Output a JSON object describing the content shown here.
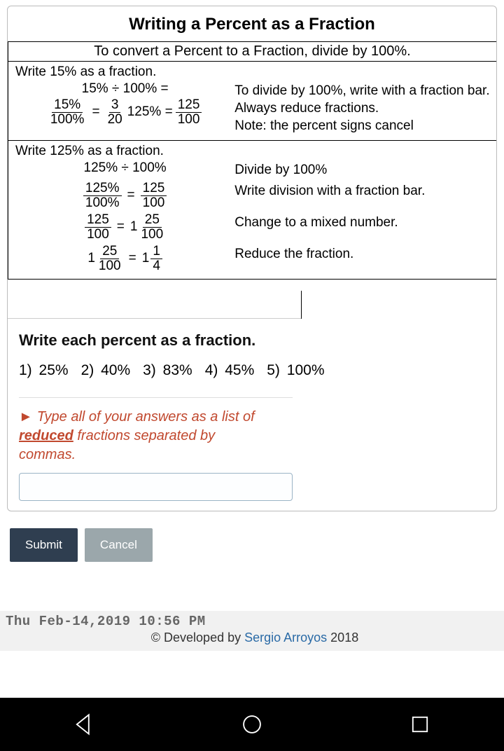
{
  "title": "Writing a Percent as a Fraction",
  "lesson": {
    "top_rule": "To convert a Percent to a Fraction, divide by 100%.",
    "ex1": {
      "prompt": "Write 15% as a fraction.",
      "line1": "15% ÷ 100% =",
      "f1_num": "15%",
      "f1_den": "100%",
      "f2_num": "3",
      "f2_den": "20",
      "mid_text": " 125% = ",
      "f3_num": "125",
      "f3_den": "100",
      "note1": "To divide by 100%, write with a fraction bar.",
      "note2": "Always reduce fractions.",
      "note3": "Note:  the percent signs cancel"
    },
    "ex2": {
      "prompt": "Write 125% as a fraction.",
      "line1": "125% ÷ 100%",
      "f1_num": "125%",
      "f1_den": "100%",
      "f2_num": "125",
      "f2_den": "100",
      "f3_num": "125",
      "f3_den": "100",
      "mix1_whole": "1",
      "mix1_num": "25",
      "mix1_den": "100",
      "mix2_whole": "1",
      "mix2_num": "25",
      "mix2_den": "100",
      "mix3_whole": "1",
      "mix3_num": "1",
      "mix3_den": "4",
      "note1": "Divide by 100%",
      "note2": "Write division with a fraction bar.",
      "note3": "Change to a mixed number.",
      "note4": "Reduce the fraction."
    }
  },
  "exercise": {
    "heading": "Write each percent as a fraction.",
    "items": [
      {
        "n": "1)",
        "v": "25%"
      },
      {
        "n": "2)",
        "v": "40%"
      },
      {
        "n": "3)",
        "v": "83%"
      },
      {
        "n": "4)",
        "v": "45%"
      },
      {
        "n": "5)",
        "v": "100%"
      }
    ]
  },
  "hint": {
    "pre": "Type all of your answers as a list of ",
    "ul": "reduced",
    "post": " fractions separated by commas."
  },
  "buttons": {
    "submit": "Submit",
    "cancel": "Cancel"
  },
  "status": {
    "timestamp": "Thu Feb-14,2019 10:56 PM",
    "copyleft": "© Developed by ",
    "author": "Sergio Arroyos",
    "year": " 2018"
  }
}
